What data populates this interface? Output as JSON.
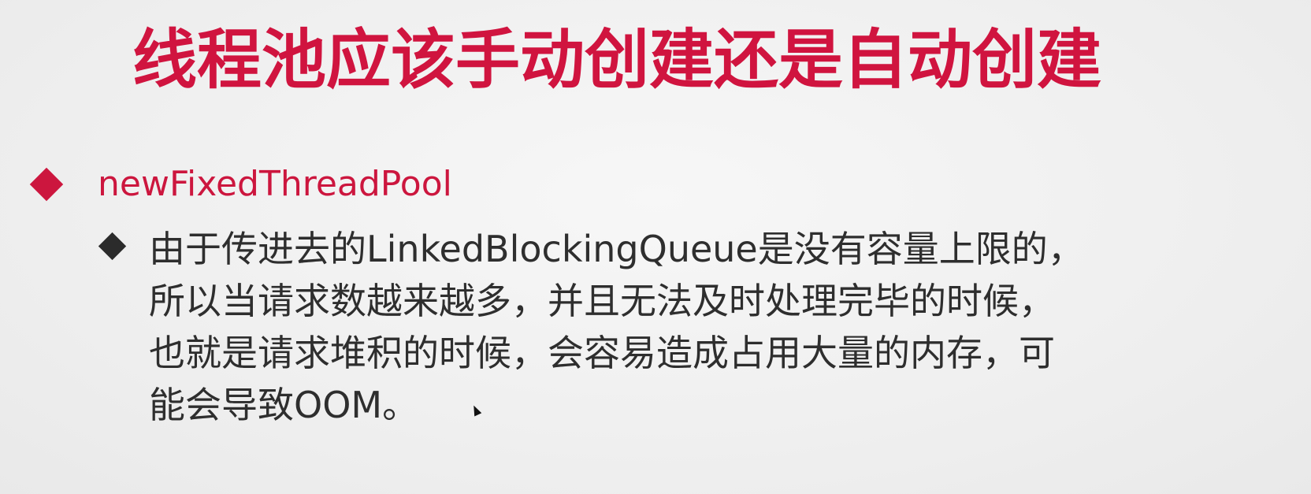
{
  "slide": {
    "title": "线程池应该手动创建还是自动创建",
    "bullet1": {
      "text": "newFixedThreadPool"
    },
    "bullet2": {
      "lines": [
        "由于传进去的LinkedBlockingQueue是没有容量上限的，",
        "所以当请求数越来越多，并且无法及时处理完毕的时候，",
        "也就是请求堆积的时候，会容易造成占用大量的内存，可",
        "能会导致OOM。"
      ]
    }
  },
  "colors": {
    "title": "#d0143f",
    "bullet1": "#cc163e",
    "body_text": "#2e2e2e",
    "background": "#f1f1f1"
  }
}
